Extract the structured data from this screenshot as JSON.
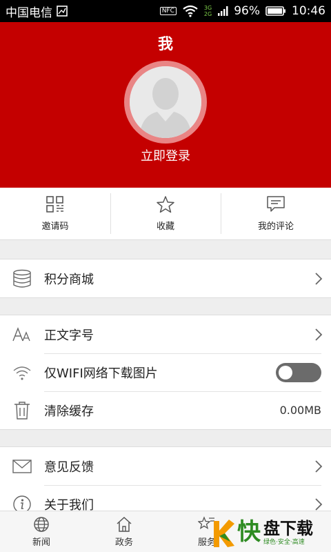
{
  "statusbar": {
    "carrier": "中国电信",
    "battery": "96%",
    "time": "10:46",
    "nfc": "NFC",
    "net_top": "3G",
    "net_bottom": "2G"
  },
  "header": {
    "title": "我",
    "login": "立即登录"
  },
  "quick": [
    {
      "label": "邀请码",
      "icon": "qr-code-icon"
    },
    {
      "label": "收藏",
      "icon": "star-icon"
    },
    {
      "label": "我的评论",
      "icon": "comment-icon"
    }
  ],
  "menu": {
    "mall": "积分商城",
    "font_size": "正文字号",
    "wifi_only": "仅WIFI网络下载图片",
    "clear_cache": "清除缓存",
    "cache_size": "0.00MB",
    "feedback": "意见反馈",
    "about": "关于我们"
  },
  "bottomnav": [
    {
      "label": "新闻",
      "icon": "globe-icon"
    },
    {
      "label": "政务",
      "icon": "home-icon"
    },
    {
      "label": "服务",
      "icon": "services-icon"
    }
  ],
  "watermark": {
    "brand": "快",
    "name": "盘下载",
    "tagline": "绿色·安全·高速"
  },
  "colors": {
    "header": "#c40000",
    "watermark_green": "#2e8b22",
    "watermark_orange": "#f39a00"
  }
}
